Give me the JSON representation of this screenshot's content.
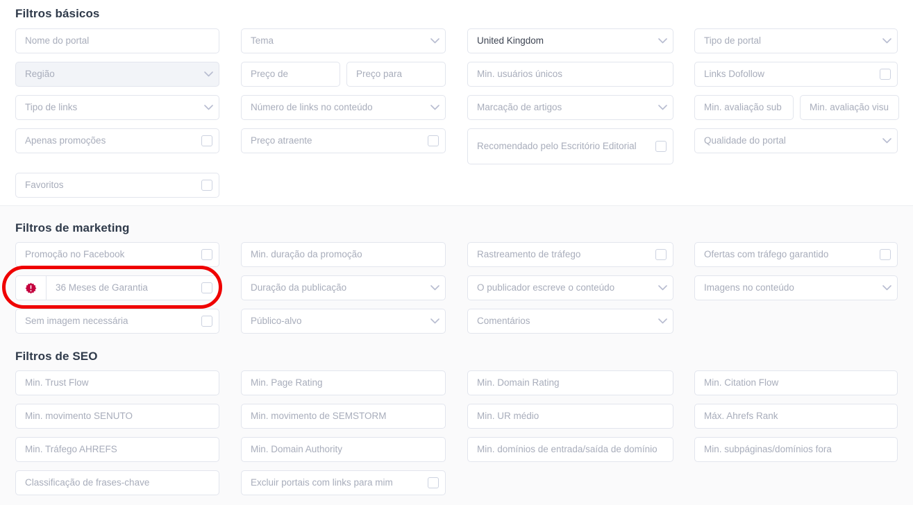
{
  "sections": {
    "basic": {
      "title": "Filtros básicos"
    },
    "marketing": {
      "title": "Filtros de marketing"
    },
    "seo": {
      "title": "Filtros de SEO"
    }
  },
  "colors": {
    "highlight": "#ef0000",
    "badge": "#c4043f",
    "placeholder": "#a8adbb",
    "value_text": "#3d4452",
    "field_border": "#e2e5ed",
    "section_bg": "#fafafb"
  },
  "basic_fields": {
    "portal_name": "Nome do portal",
    "theme": "Tema",
    "country": "United Kingdom",
    "portal_type": "Tipo de portal",
    "region": "Região",
    "price_from": "Preço de",
    "price_to": "Preço para",
    "min_unique_users": "Min. usuários únicos",
    "dofollow_links": "Links Dofollow",
    "link_type": "Tipo de links",
    "links_in_content": "Número de links no conteúdo",
    "article_marking": "Marcação de artigos",
    "min_rating_sub": "Min. avaliação sub",
    "min_rating_vis": "Min. avaliação visu",
    "promotions_only": "Apenas promoções",
    "attractive_price": "Preço atraente",
    "editorial_recommended": "Recomendado pelo Escritório Editorial",
    "portal_quality": "Qualidade do portal",
    "favorites": "Favoritos"
  },
  "marketing_fields": {
    "facebook_promo": "Promoção no Facebook",
    "min_promo_duration": "Min. duração da promoção",
    "traffic_tracking": "Rastreamento de tráfego",
    "guaranteed_traffic_offers": "Ofertas com tráfego garantido",
    "warranty_36_months": "36 Meses de Garantia",
    "publication_duration": "Duração da publicação",
    "publisher_writes_content": "O publicador escreve o conteúdo",
    "images_in_content": "Imagens no conteúdo",
    "no_image_needed": "Sem imagem necessária",
    "target_audience": "Público-alvo",
    "comments": "Comentários"
  },
  "seo_fields": {
    "min_trust_flow": "Min. Trust Flow",
    "min_page_rating": "Min. Page Rating",
    "min_domain_rating": "Min. Domain Rating",
    "min_citation_flow": "Min. Citation Flow",
    "min_senuto": "Min. movimento SENUTO",
    "min_semstorm": "Min. movimento de SEMSTORM",
    "min_ur": "Min. UR médio",
    "max_ahrefs_rank": "Máx. Ahrefs Rank",
    "min_ahrefs_traffic": "Min. Tráfego AHREFS",
    "min_domain_authority": "Min. Domain Authority",
    "min_in_out_domains": "Min. domínios de entrada/saída de domínio",
    "min_subpages_domains": "Min. subpáginas/domínios fora",
    "keyword_ranking": "Classificação de frases-chave",
    "exclude_portals_linking": "Excluir portais com links para mim"
  }
}
